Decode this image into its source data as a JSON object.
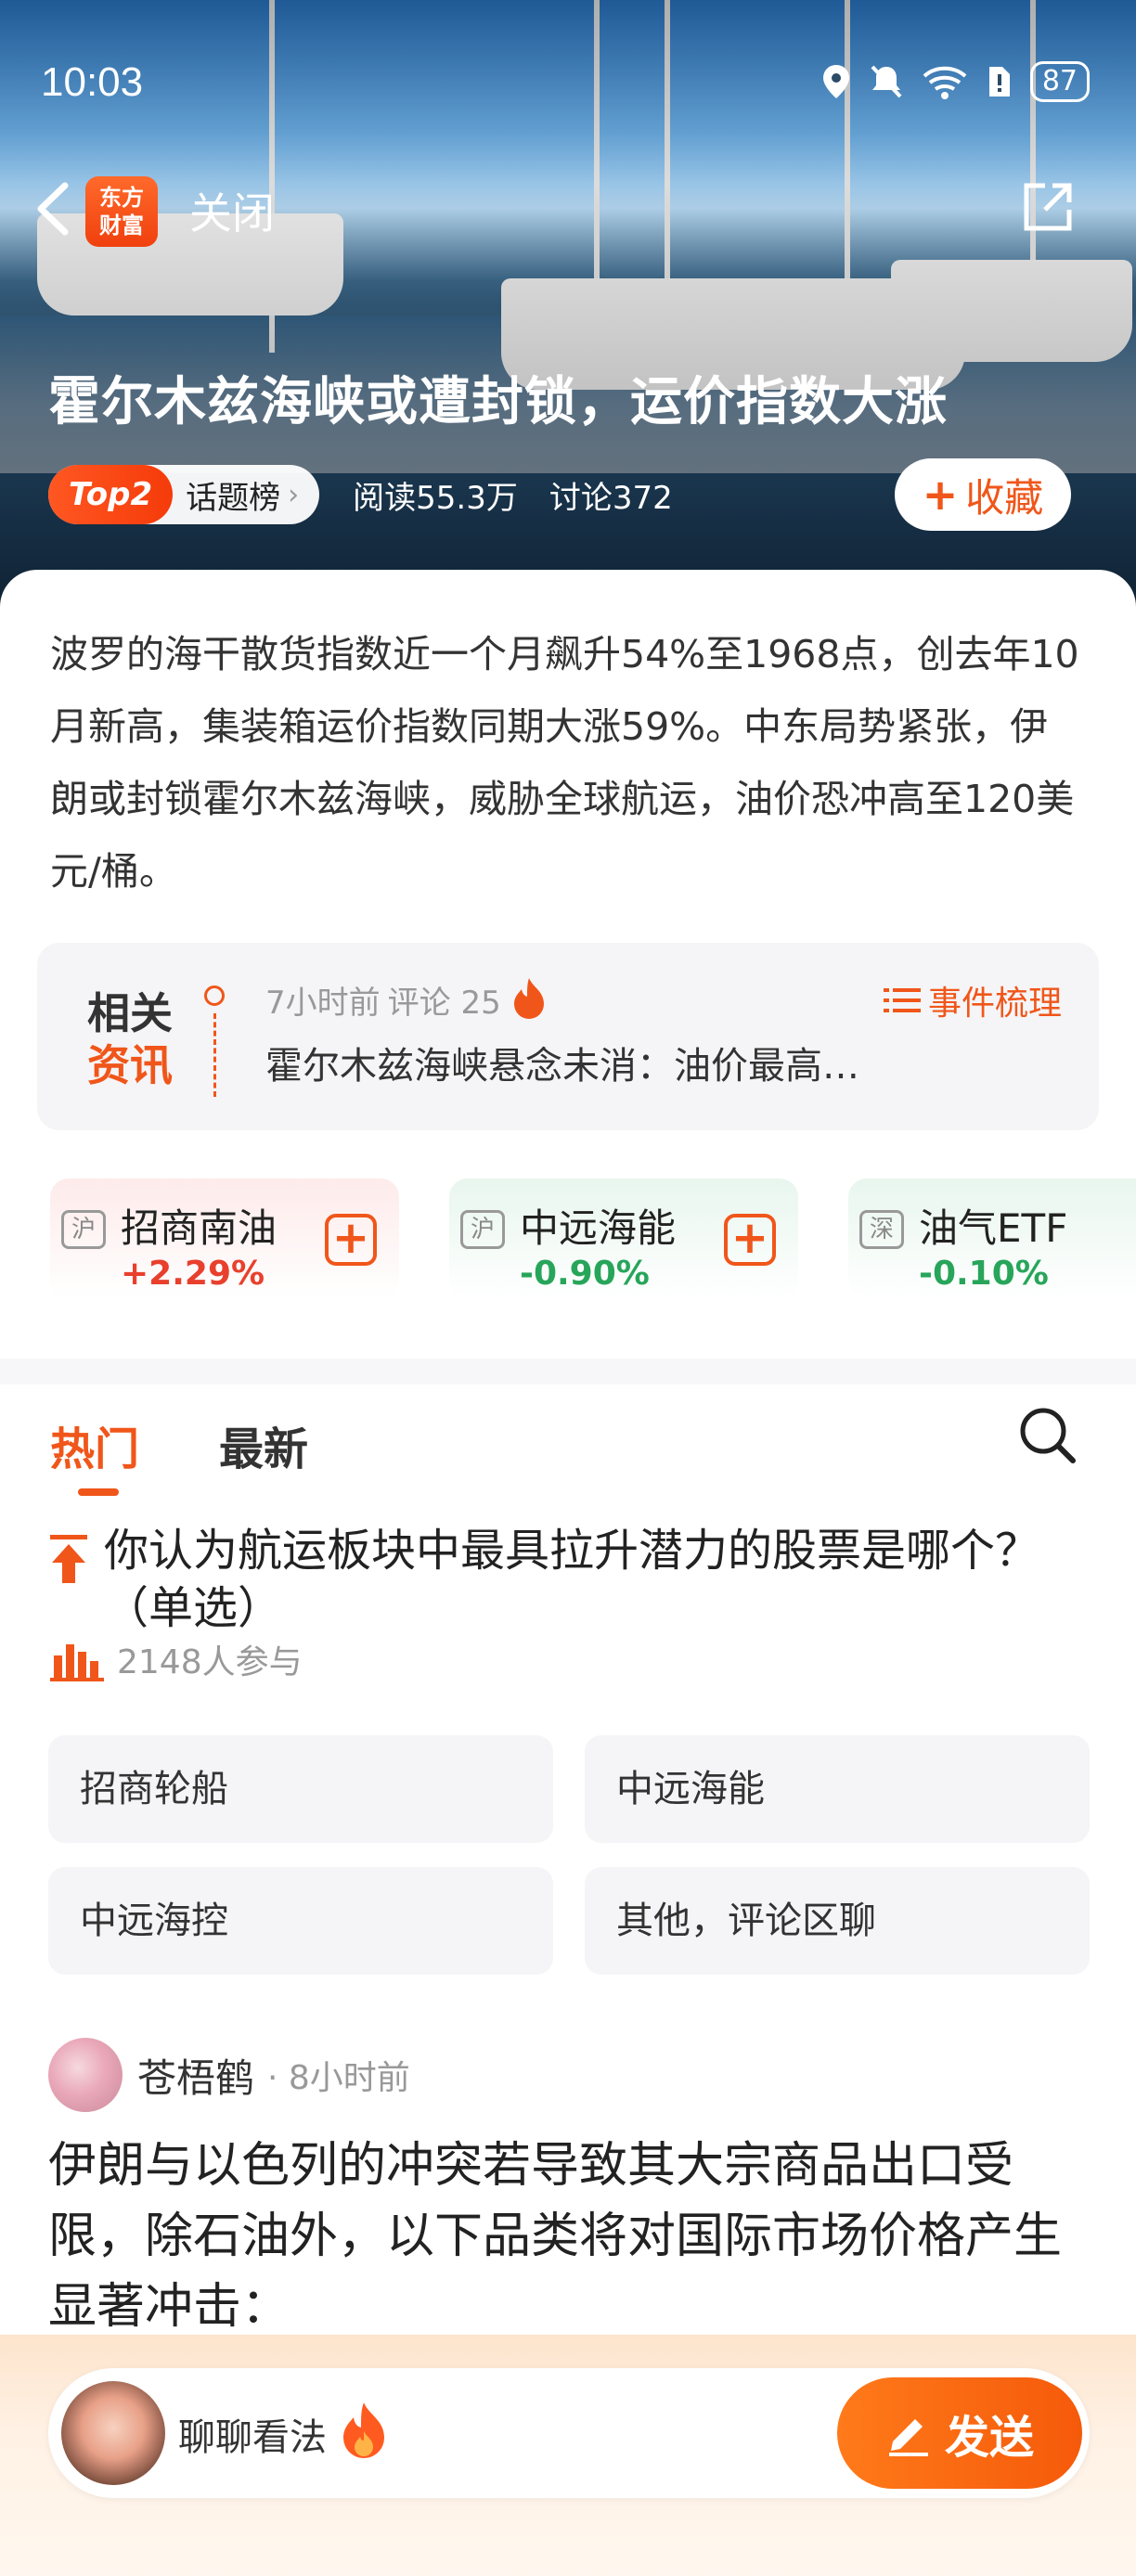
{
  "status_bar": {
    "time": "10:03",
    "battery": "87"
  },
  "nav": {
    "logo_text_top": "东方",
    "logo_text_bottom": "财富",
    "close_label": "关闭"
  },
  "hero": {
    "title": "霍尔木兹海峡或遭封锁，运价指数大涨",
    "rank_badge": "Top2",
    "rank_label": "话题榜",
    "reads": "阅读55.3万",
    "discussions": "讨论372",
    "favorite_label": "收藏"
  },
  "summary": {
    "text": "波罗的海干散货指数近一个月飙升54%至1968点，创去年10月新高，集装箱运价指数同期大涨59%。中东局势紧张，伊朗或封锁霍尔木兹海峡，威胁全球航运，油价恐冲高至120美元/桶。"
  },
  "related": {
    "tag_line1": "相关",
    "tag_line2": "资讯",
    "time": "7小时前",
    "comments": "评论 25",
    "headline": "霍尔木兹海峡悬念未消：油价最高…",
    "event_label": "事件梳理"
  },
  "stocks": [
    {
      "exchange": "沪",
      "name": "招商南油",
      "change": "+2.29%",
      "trend": "up"
    },
    {
      "exchange": "沪",
      "name": "中远海能",
      "change": "-0.90%",
      "trend": "down"
    },
    {
      "exchange": "深",
      "name": "油气ETF",
      "change": "-0.10%",
      "trend": "down"
    }
  ],
  "tabs": [
    {
      "label": "热门"
    },
    {
      "label": "最新"
    }
  ],
  "poll": {
    "question": "你认为航运板块中最具拉升潜力的股票是哪个？ （单选）",
    "participants": "2148人参与",
    "options": [
      "招商轮船",
      "中远海能",
      "中远海控",
      "其他，评论区聊"
    ]
  },
  "post": {
    "author": "苍梧鹤",
    "time": "8小时前",
    "text": "伊朗与以色列的冲突若导致其大宗商品出口受限，除石油外，以下品类将对国际市场价格产生显著冲击："
  },
  "bottom_bar": {
    "placeholder": "聊聊看法",
    "send_label": "发送"
  },
  "colors": {
    "accent": "#f0561a",
    "up": "#e8402d",
    "down": "#27a55a"
  }
}
